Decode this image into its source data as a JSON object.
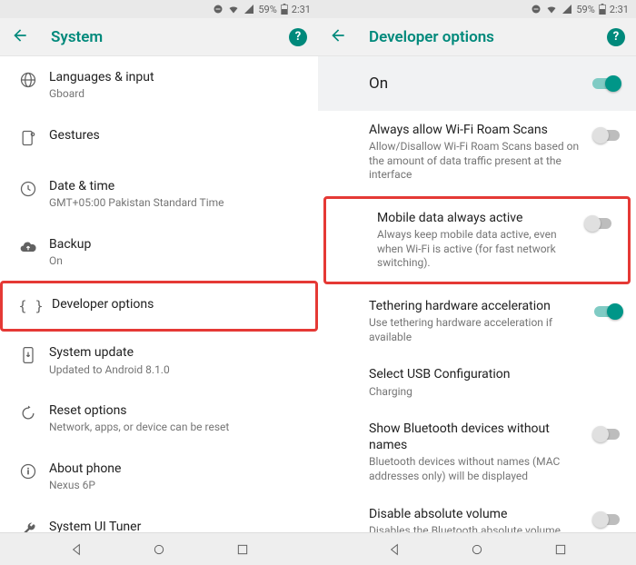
{
  "statusbar": {
    "battery_pct": "59%",
    "time": "2:31"
  },
  "left": {
    "title": "System",
    "items": [
      {
        "title": "Languages & input",
        "subtitle": "Gboard"
      },
      {
        "title": "Gestures",
        "subtitle": ""
      },
      {
        "title": "Date & time",
        "subtitle": "GMT+05:00 Pakistan Standard Time"
      },
      {
        "title": "Backup",
        "subtitle": "On"
      },
      {
        "title": "Developer options",
        "subtitle": ""
      },
      {
        "title": "System update",
        "subtitle": "Updated to Android 8.1.0"
      },
      {
        "title": "Reset options",
        "subtitle": "Network, apps, or device can be reset"
      },
      {
        "title": "About phone",
        "subtitle": "Nexus 6P"
      },
      {
        "title": "System UI Tuner",
        "subtitle": ""
      }
    ]
  },
  "right": {
    "title": "Developer options",
    "master_label": "On",
    "items": [
      {
        "title": "Always allow Wi-Fi Roam Scans",
        "subtitle": "Allow/Disallow Wi-Fi Roam Scans based on the amount of data traffic present at the interface",
        "toggle": "off"
      },
      {
        "title": "Mobile data always active",
        "subtitle": "Always keep mobile data active, even when Wi-Fi is active (for fast network switching).",
        "toggle": "off"
      },
      {
        "title": "Tethering hardware acceleration",
        "subtitle": "Use tethering hardware acceleration if available",
        "toggle": "on"
      },
      {
        "title": "Select USB Configuration",
        "subtitle": "Charging",
        "toggle": ""
      },
      {
        "title": "Show Bluetooth devices without names",
        "subtitle": "Bluetooth devices without names (MAC addresses only) will be displayed",
        "toggle": "off"
      },
      {
        "title": "Disable absolute volume",
        "subtitle": "Disables the Bluetooth absolute volume feature in case of volume issues with",
        "toggle": "off"
      }
    ]
  }
}
